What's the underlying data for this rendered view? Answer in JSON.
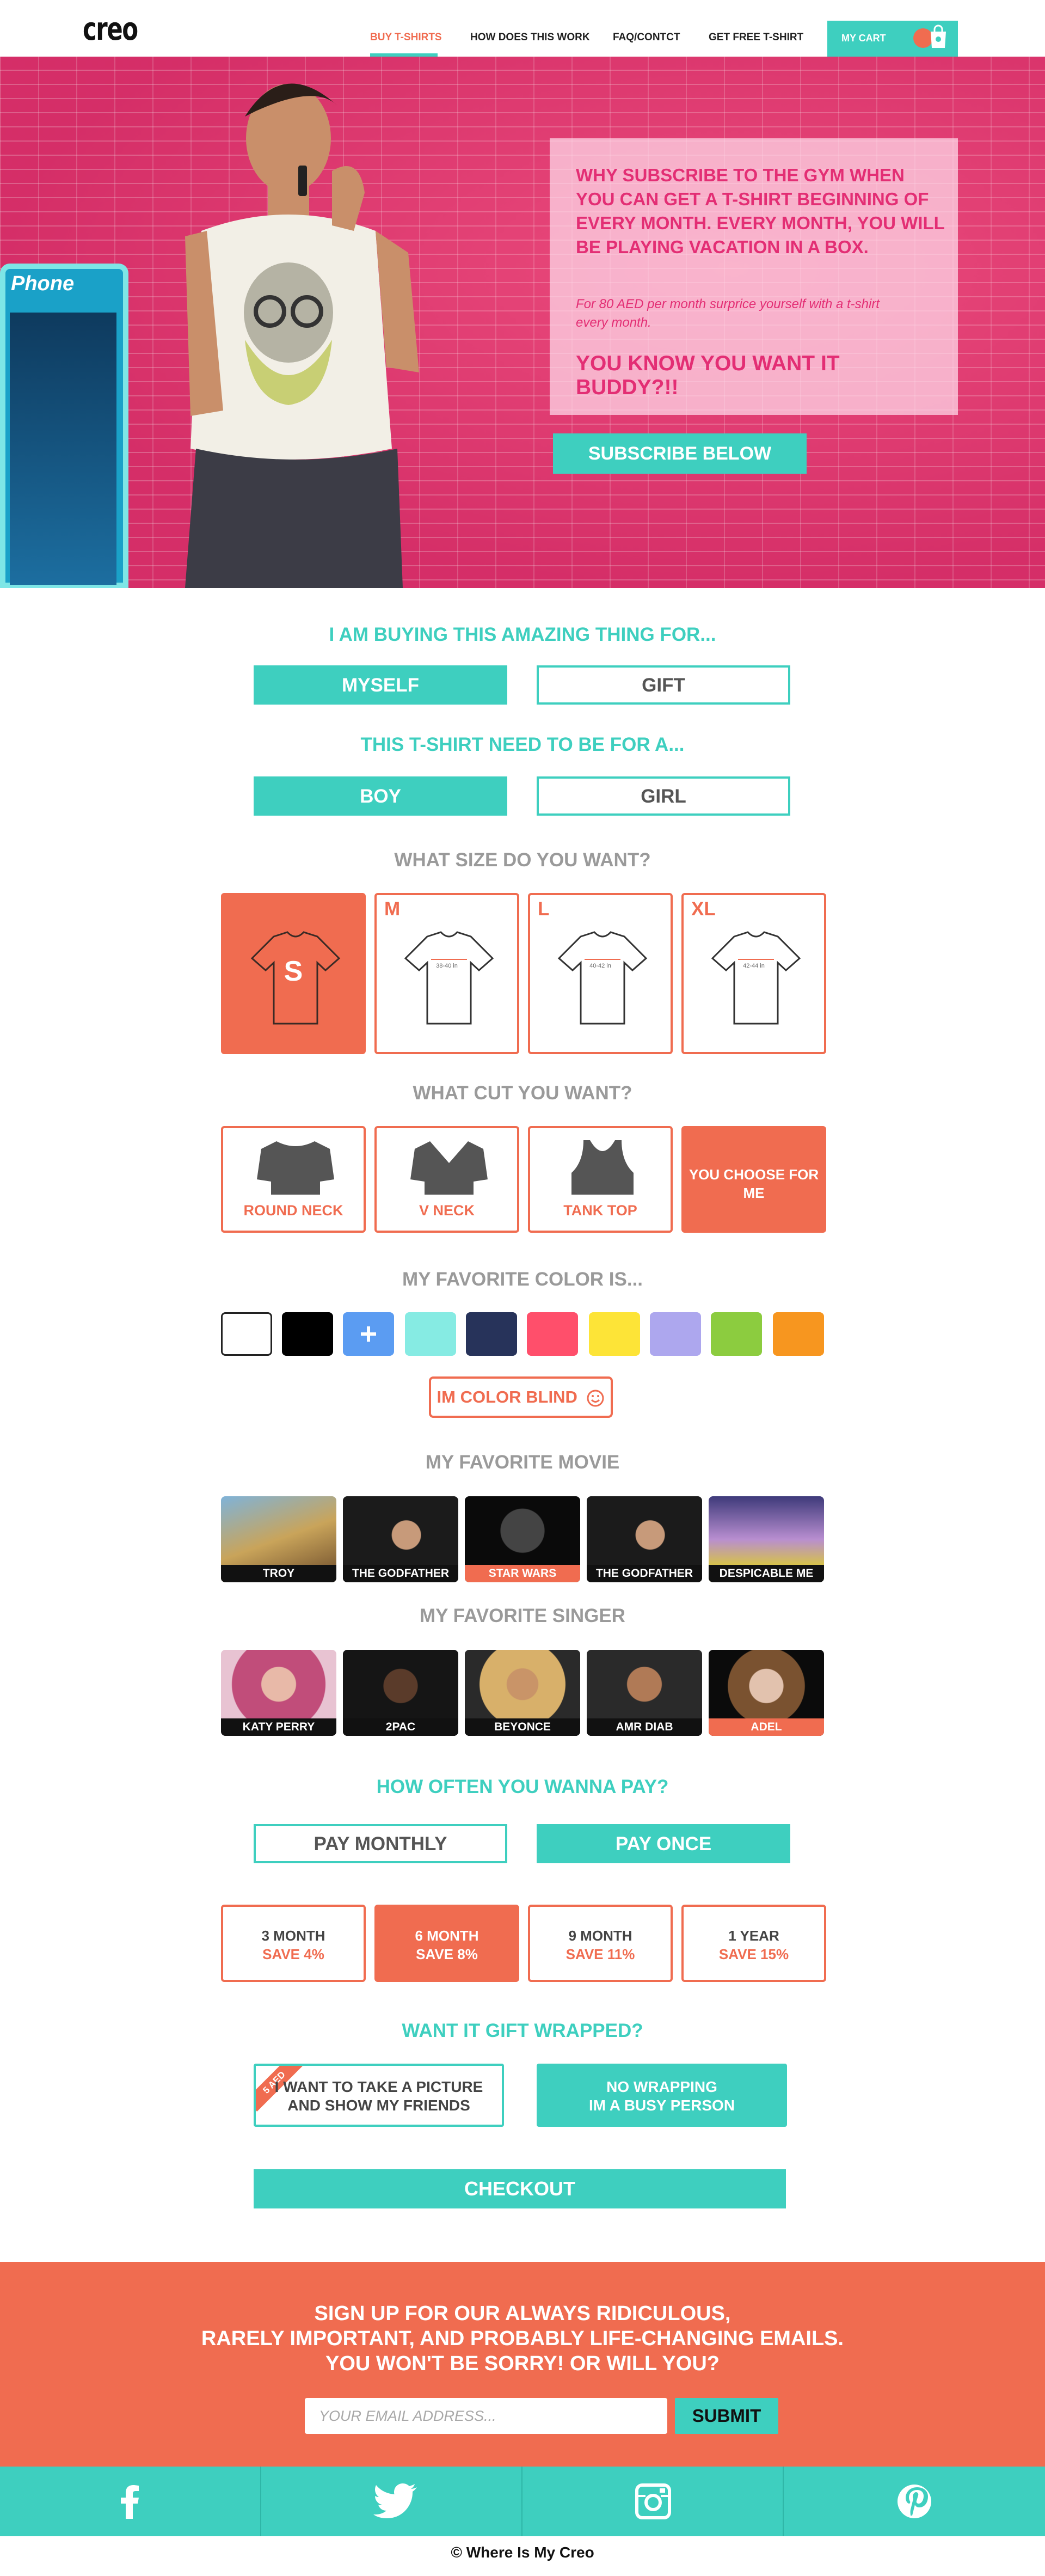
{
  "header": {
    "logo": "creo",
    "nav": [
      {
        "label": "BUY T-SHIRTS",
        "active": true
      },
      {
        "label": "HOW DOES THIS WORK",
        "active": false
      },
      {
        "label": "FAQ/CONTCT",
        "active": false
      },
      {
        "label": "GET FREE T-SHIRT",
        "active": false
      }
    ],
    "cart_label": "MY CART"
  },
  "hero": {
    "booth_label": "Phone",
    "headline": "WHY SUBSCRIBE TO THE GYM WHEN YOU CAN GET A T-SHIRT BEGINNING OF EVERY MONTH. EVERY MONTH, YOU WILL BE PLAYING VACATION IN A BOX.",
    "subtext": "For 80 AED per month surprice yourself with a t-shirt every month.",
    "tagline": "YOU KNOW YOU WANT IT BUDDY?!!",
    "cta": "SUBSCRIBE BELOW"
  },
  "buying_for": {
    "title": "I AM BUYING THIS AMAZING THING FOR...",
    "options": [
      {
        "label": "MYSELF",
        "selected": true
      },
      {
        "label": "GIFT",
        "selected": false
      }
    ]
  },
  "gender": {
    "title": "THIS T-SHIRT NEED TO BE FOR A...",
    "options": [
      {
        "label": "BOY",
        "selected": true
      },
      {
        "label": "GIRL",
        "selected": false
      }
    ]
  },
  "size": {
    "title": "WHAT SIZE DO YOU WANT?",
    "options": [
      {
        "label": "S",
        "measure": "",
        "selected": true
      },
      {
        "label": "M",
        "measure": "38-40 in",
        "selected": false
      },
      {
        "label": "L",
        "measure": "40-42 in",
        "selected": false
      },
      {
        "label": "XL",
        "measure": "42-44 in",
        "selected": false
      }
    ]
  },
  "cut": {
    "title": "WHAT CUT YOU WANT?",
    "options": [
      {
        "label": "ROUND NECK",
        "icon": "round-neck-shirt-icon"
      },
      {
        "label": "V NECK",
        "icon": "v-neck-shirt-icon"
      },
      {
        "label": "TANK TOP",
        "icon": "tank-top-icon"
      },
      {
        "label": "YOU CHOOSE FOR ME",
        "selected": true
      }
    ]
  },
  "color": {
    "title": "MY FAVORITE COLOR IS...",
    "swatches": [
      "#ffffff",
      "#000000",
      "#5b9cf2",
      "#86ebe3",
      "#27335a",
      "#ff4f6b",
      "#fde437",
      "#ada7ee",
      "#8ccc3f",
      "#f7961f"
    ],
    "add_swatch_index": 2,
    "colorblind": "IM COLOR BLIND"
  },
  "movie": {
    "title": "MY FAVORITE MOVIE",
    "items": [
      {
        "label": "TROY",
        "selected": false
      },
      {
        "label": "THE GODFATHER",
        "selected": false
      },
      {
        "label": "STAR WARS",
        "selected": true
      },
      {
        "label": "THE GODFATHER",
        "selected": false
      },
      {
        "label": "DESPICABLE ME",
        "selected": false
      }
    ]
  },
  "singer": {
    "title": "MY FAVORITE SINGER",
    "items": [
      {
        "label": "KATY PERRY",
        "selected": false
      },
      {
        "label": "2PAC",
        "selected": false
      },
      {
        "label": "BEYONCE",
        "selected": false
      },
      {
        "label": "AMR DIAB",
        "selected": false
      },
      {
        "label": "ADEL",
        "selected": true
      }
    ]
  },
  "payment": {
    "title": "HOW OFTEN YOU WANNA PAY?",
    "options": [
      {
        "label": "PAY MONTHLY",
        "selected": false
      },
      {
        "label": "PAY ONCE",
        "selected": true
      }
    ],
    "plans": [
      {
        "term": "3 MONTH",
        "save": "SAVE 4%",
        "selected": false
      },
      {
        "term": "6 MONTH",
        "save": "SAVE 8%",
        "selected": true
      },
      {
        "term": "9 MONTH",
        "save": "SAVE 11%",
        "selected": false
      },
      {
        "term": "1 YEAR",
        "save": "SAVE 15%",
        "selected": false
      }
    ]
  },
  "wrap": {
    "title": "WANT IT GIFT WRAPPED?",
    "ribbon": "5 AED",
    "options": [
      {
        "line1": "I WANT TO TAKE A PICTURE",
        "line2": "AND SHOW MY FRIENDS",
        "selected": false
      },
      {
        "line1": "NO WRAPPING",
        "line2": "IM A BUSY PERSON",
        "selected": true
      }
    ]
  },
  "checkout": "CHECKOUT",
  "newsletter": {
    "line1": "SIGN UP FOR OUR ALWAYS RIDICULOUS,",
    "line2": "RARELY IMPORTANT, AND PROBABLY LIFE-CHANGING EMAILS.",
    "line3": "YOU WON'T BE SORRY! OR WILL YOU?",
    "placeholder": "YOUR EMAIL ADDRESS...",
    "submit": "SUBMIT"
  },
  "social": [
    "facebook-icon",
    "twitter-icon",
    "instagram-icon",
    "pinterest-icon"
  ],
  "footer": "© Where Is My Creo",
  "colors": {
    "teal": "#3ecfbf",
    "coral": "#f06c50",
    "hero_pink": "#e32e74"
  }
}
